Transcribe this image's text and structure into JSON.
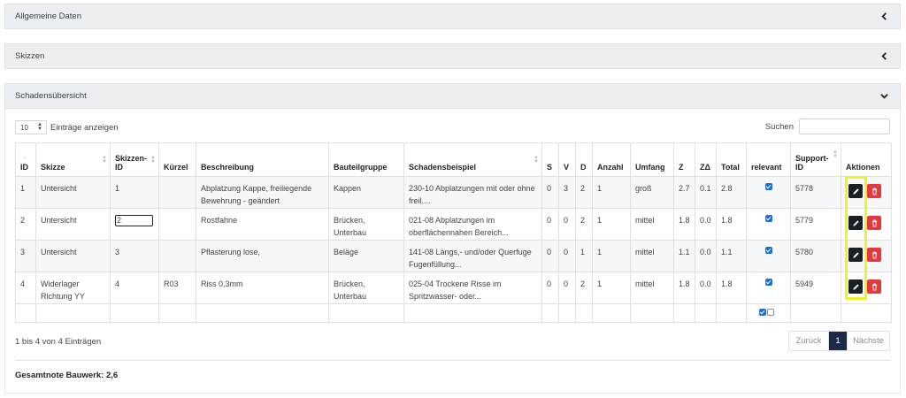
{
  "panels": [
    {
      "title": "Allgemeine Daten",
      "icon": "chevron-left-icon"
    },
    {
      "title": "Skizzen",
      "icon": "chevron-left-icon"
    },
    {
      "title": "Schadensübersicht",
      "icon": "chevron-down-icon"
    }
  ],
  "length_control": {
    "value": "10",
    "label": "Einträge anzeigen"
  },
  "search": {
    "label": "Suchen",
    "value": ""
  },
  "columns": [
    "ID",
    "Skizze",
    "Skizzen-ID",
    "Kürzel",
    "Beschreibung",
    "Bauteilgruppe",
    "Schadensbeispiel",
    "S",
    "V",
    "D",
    "Anzahl",
    "Umfang",
    "Z",
    "ZΔ",
    "Total",
    "relevant",
    "Support-ID",
    "Aktionen"
  ],
  "rows": [
    {
      "id": "1",
      "skizze": "Untersicht",
      "skizzen_id": "1",
      "kuerzel": "",
      "beschreibung": "Abplatzung Kappe, freiliegende Bewehrung - geändert",
      "bauteilgruppe": "Kappen",
      "schadensbeispiel": "230-10 Abplatzungen mit oder ohne freil....",
      "s": "0",
      "v": "3",
      "d": "2",
      "anzahl": "1",
      "umfang": "groß",
      "z": "2.7",
      "zd": "0.1",
      "total": "2.8",
      "relevant": true,
      "support_id": "5778"
    },
    {
      "id": "2",
      "skizze": "Untersicht",
      "skizzen_id": "2",
      "kuerzel": "",
      "beschreibung": "Rostfahne",
      "bauteilgruppe": "Brücken, Unterbau",
      "schadensbeispiel": "021-08 Abplatzungen im oberflächennahen Bereich...",
      "s": "0",
      "v": "0",
      "d": "2",
      "anzahl": "1",
      "umfang": "mittel",
      "z": "1.8",
      "zd": "0.0",
      "total": "1.8",
      "relevant": true,
      "support_id": "5779"
    },
    {
      "id": "3",
      "skizze": "Untersicht",
      "skizzen_id": "3",
      "kuerzel": "",
      "beschreibung": "Pflasterung lose,",
      "bauteilgruppe": "Beläge",
      "schadensbeispiel": "141-08 Längs,- und/oder Querfuge Fugenfüllung...",
      "s": "0",
      "v": "0",
      "d": "1",
      "anzahl": "1",
      "umfang": "mittel",
      "z": "1.1",
      "zd": "0.0",
      "total": "1.1",
      "relevant": true,
      "support_id": "5780"
    },
    {
      "id": "4",
      "skizze": "Widerlager Richtung YY",
      "skizzen_id": "4",
      "kuerzel": "R03",
      "beschreibung": "Riss 0,3mm",
      "bauteilgruppe": "Brücken, Unterbau",
      "schadensbeispiel": "025-04 Trockene Risse im Spritzwasser- oder...",
      "s": "0",
      "v": "0",
      "d": "2",
      "anzahl": "1",
      "umfang": "mittel",
      "z": "1.8",
      "zd": "0.0",
      "total": "1.8",
      "relevant": true,
      "support_id": "5949"
    }
  ],
  "info": "1 bis 4 von 4 Einträgen",
  "pagination": {
    "prev": "Zurück",
    "page": "1",
    "next": "Nächste"
  },
  "total": "Gesamtnote Bauwerk: 2,6",
  "colors": {
    "accent": "#1c2a45",
    "edit": "#1a1f24",
    "delete": "#e23a3f",
    "highlight": "#eef22a",
    "checkbox": "#1a6ee8"
  }
}
